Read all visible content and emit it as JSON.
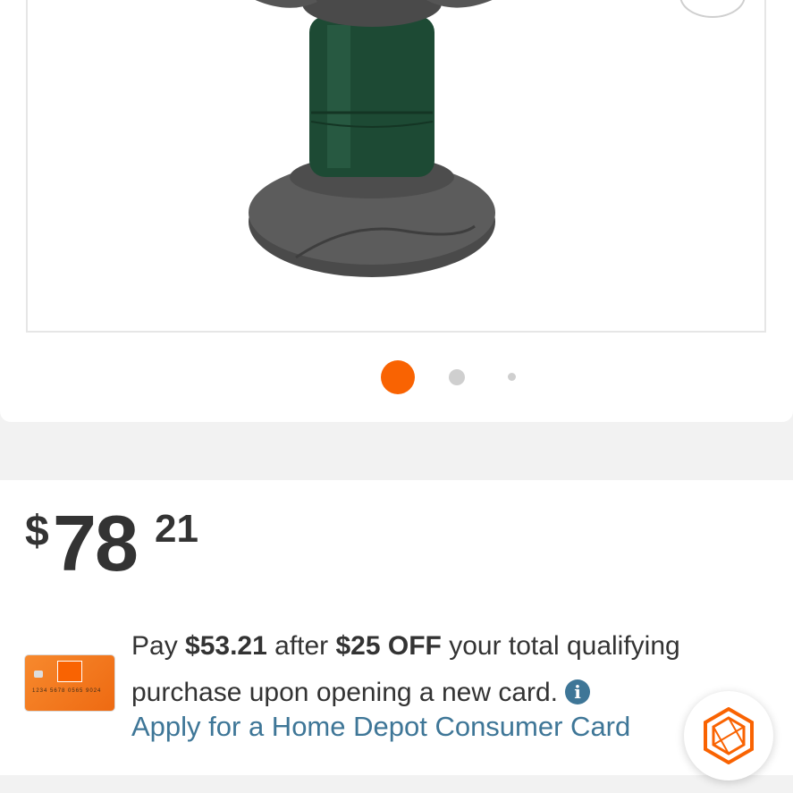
{
  "gallery": {
    "dots_count": 3,
    "active_index": 0
  },
  "price": {
    "symbol": "$",
    "dollars": "78",
    "cents": "21"
  },
  "offer": {
    "pay_prefix": "Pay ",
    "discounted_price": "$53.21",
    "after_text": " after ",
    "discount": "$25 OFF",
    "suffix": " your total qualifying purchase upon opening a new card.",
    "info_glyph": "i",
    "info_icon": "info-circle-icon",
    "apply_link": "Apply for a Home Depot Consumer Card"
  },
  "card_image": {
    "number": "1234 5678 0565 9024"
  },
  "colors": {
    "brand_orange": "#f96302",
    "link_blue": "#3e7697",
    "text": "#333333"
  },
  "chat": {
    "icon": "hexagon-chat-icon"
  }
}
